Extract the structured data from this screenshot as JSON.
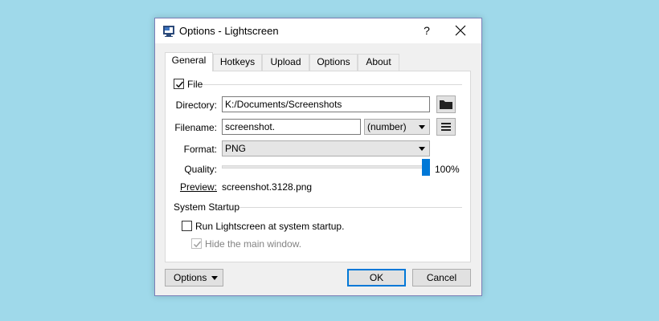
{
  "window": {
    "title": "Options - Lightscreen",
    "help_label": "?"
  },
  "tabs": [
    {
      "label": "General",
      "active": true
    },
    {
      "label": "Hotkeys",
      "active": false
    },
    {
      "label": "Upload",
      "active": false
    },
    {
      "label": "Options",
      "active": false
    },
    {
      "label": "About",
      "active": false
    }
  ],
  "file_group": {
    "label": "File",
    "checked": true,
    "directory_label": "Directory:",
    "directory_value": "K:/Documents/Screenshots",
    "filename_label": "Filename:",
    "filename_value": "screenshot.",
    "naming_value": "(number)",
    "format_label": "Format:",
    "format_value": "PNG",
    "quality_label": "Quality:",
    "quality_value": "100%",
    "quality_level": 1.0,
    "preview_label": "Preview:",
    "preview_value": "screenshot.3128.png",
    "icons": {
      "directory_button": "folder-icon",
      "naming_button": "menu-icon"
    }
  },
  "startup_group": {
    "label": "System Startup",
    "run_at_startup_label": "Run Lightscreen at system startup.",
    "run_at_startup_checked": false,
    "hide_window_label": "Hide the main window.",
    "hide_window_checked": true,
    "hide_window_enabled": false
  },
  "footer": {
    "options_label": "Options",
    "ok_label": "OK",
    "cancel_label": "Cancel"
  },
  "colors": {
    "background": "#9fd9ea",
    "accent": "#0078d7",
    "window_border": "#7a7fb8"
  }
}
